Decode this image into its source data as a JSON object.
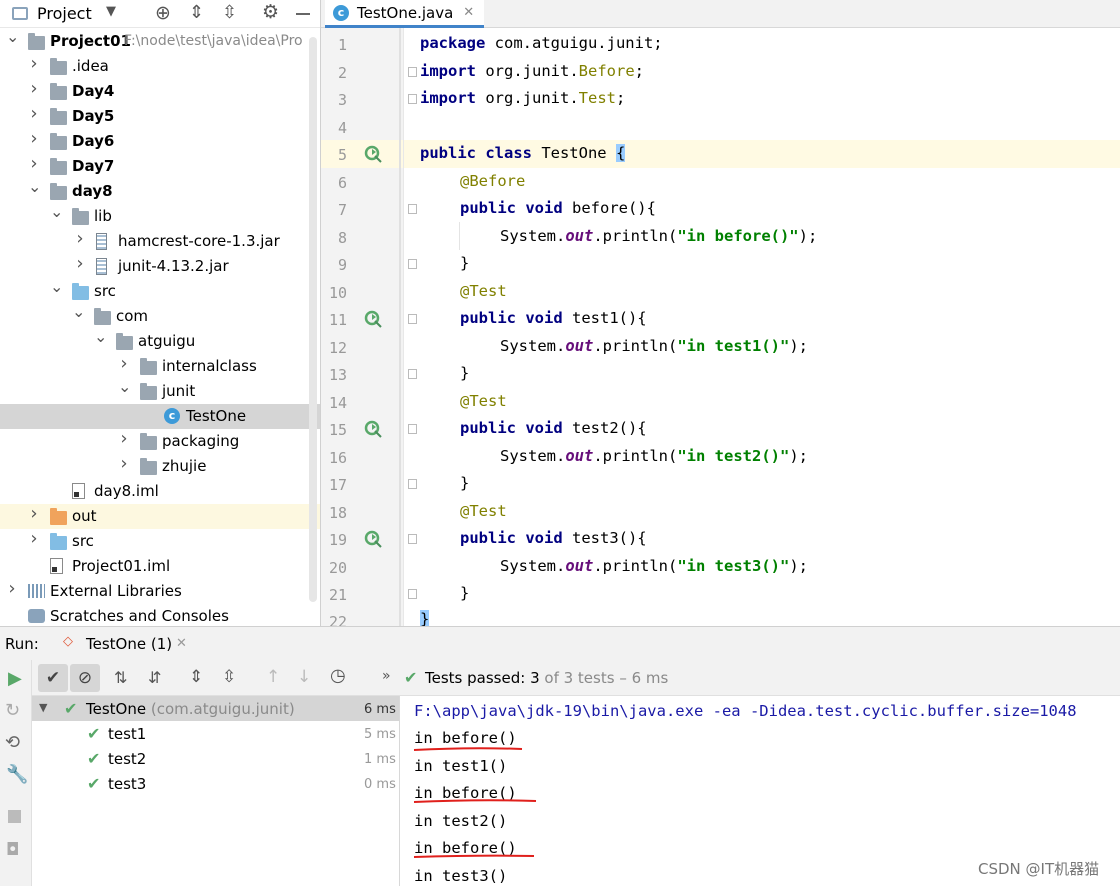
{
  "project_panel": {
    "title": "Project",
    "tree": [
      {
        "label": "Project01",
        "path": "F:\\node\\test\\java\\idea\\Pro",
        "bold": true,
        "expanded": true,
        "icon": "module-folder-icon"
      },
      {
        "label": ".idea",
        "icon": "folder-icon"
      },
      {
        "label": "Day4",
        "bold": true,
        "icon": "module-folder-icon"
      },
      {
        "label": "Day5",
        "bold": true,
        "icon": "module-folder-icon"
      },
      {
        "label": "Day6",
        "bold": true,
        "icon": "module-folder-icon"
      },
      {
        "label": "Day7",
        "bold": true,
        "icon": "module-folder-icon"
      },
      {
        "label": "day8",
        "bold": true,
        "icon": "module-folder-icon"
      },
      {
        "label": "lib",
        "icon": "folder-icon"
      },
      {
        "label": "hamcrest-core-1.3.jar",
        "icon": "jar-icon"
      },
      {
        "label": "junit-4.13.2.jar",
        "icon": "jar-icon"
      },
      {
        "label": "src",
        "icon": "source-folder-icon"
      },
      {
        "label": "com",
        "icon": "package-icon"
      },
      {
        "label": "atguigu",
        "icon": "package-icon"
      },
      {
        "label": "internalclass",
        "icon": "package-icon"
      },
      {
        "label": "junit",
        "icon": "package-icon"
      },
      {
        "label": "TestOne",
        "icon": "java-class-icon"
      },
      {
        "label": "packaging",
        "icon": "package-icon"
      },
      {
        "label": "zhujie",
        "icon": "package-icon"
      },
      {
        "label": "day8.iml",
        "icon": "iml-file-icon"
      },
      {
        "label": "out",
        "icon": "excluded-folder-icon"
      },
      {
        "label": "src",
        "icon": "source-folder-icon"
      },
      {
        "label": "Project01.iml",
        "icon": "iml-file-icon"
      },
      {
        "label": "External Libraries",
        "icon": "libraries-icon"
      },
      {
        "label": "Scratches and Consoles",
        "icon": "scratches-icon"
      }
    ]
  },
  "editor": {
    "tab_label": "TestOne.java",
    "line_numbers": [
      "1",
      "2",
      "3",
      "4",
      "5",
      "6",
      "7",
      "8",
      "9",
      "10",
      "11",
      "12",
      "13",
      "14",
      "15",
      "16",
      "17",
      "18",
      "19",
      "20",
      "21",
      "22"
    ]
  },
  "code": {
    "l1_kw": "package",
    "l1_rest": " com.atguigu.junit;",
    "l2_kw": "import",
    "l2_a": " org.junit.",
    "l2_b": "Before",
    "l2_c": ";",
    "l3_kw": "import",
    "l3_a": " org.junit.",
    "l3_b": "Test",
    "l3_c": ";",
    "l5_kw": "public class",
    "l5_rest": " TestOne ",
    "l5_brace": "{",
    "l6": "@Before",
    "l7_kw": "public void",
    "l7_rest": " before(){",
    "l8_a": "System.",
    "l8_out": "out",
    "l8_b": ".println(",
    "l8_str": "\"in before()\"",
    "l8_c": ");",
    "l9": "}",
    "l10": "@Test",
    "l11_kw": "public void",
    "l11_rest": " test1(){",
    "l12_a": "System.",
    "l12_out": "out",
    "l12_b": ".println(",
    "l12_str": "\"in test1()\"",
    "l12_c": ");",
    "l13": "}",
    "l14": "@Test",
    "l15_kw": "public void",
    "l15_rest": " test2(){",
    "l16_a": "System.",
    "l16_out": "out",
    "l16_b": ".println(",
    "l16_str": "\"in test2()\"",
    "l16_c": ");",
    "l17": "}",
    "l18": "@Test",
    "l19_kw": "public void",
    "l19_rest": " test3(){",
    "l20_a": "System.",
    "l20_out": "out",
    "l20_b": ".println(",
    "l20_str": "\"in test3()\"",
    "l20_c": ");",
    "l21": "}",
    "l22": "}"
  },
  "run_panel": {
    "label": "Run:",
    "config_tab": "TestOne (1)",
    "status_prefix": "Tests passed:",
    "status_count": "3",
    "status_suffix": "of 3 tests – 6 ms",
    "tests": [
      {
        "name": "TestOne",
        "detail": "(com.atguigu.junit)",
        "time": "6 ms"
      },
      {
        "name": "test1",
        "time": "5 ms"
      },
      {
        "name": "test2",
        "time": "1 ms"
      },
      {
        "name": "test3",
        "time": "0 ms"
      }
    ],
    "console": [
      "F:\\app\\java\\jdk-19\\bin\\java.exe -ea -Didea.test.cyclic.buffer.size=1048",
      "in before()",
      "in test1()",
      "in before()",
      "in test2()",
      "in before()",
      "in test3()"
    ]
  },
  "watermark": "CSDN @IT机器猫",
  "colors": {
    "accent": "#4083c9",
    "pass": "#59a869",
    "underline": "#e0201c"
  }
}
